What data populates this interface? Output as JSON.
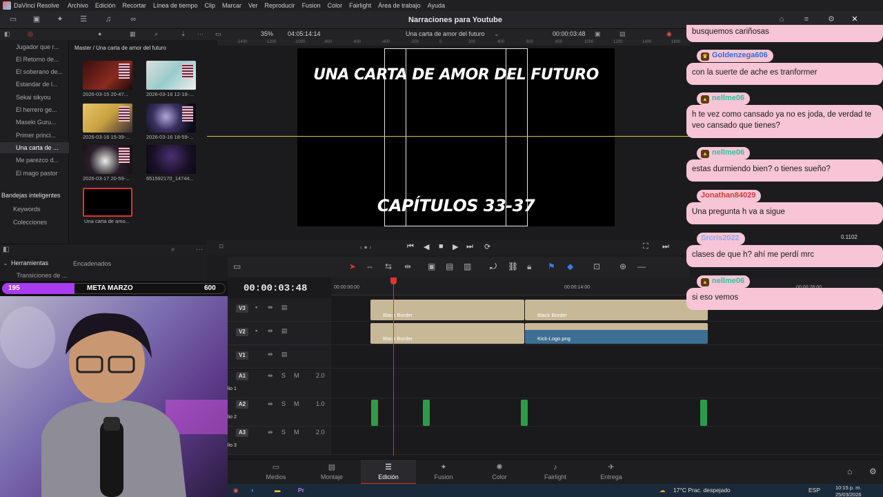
{
  "menubar": {
    "app_name": "DaVinci Resolve",
    "items": [
      "Archivo",
      "Edición",
      "Recortar",
      "Línea de tiempo",
      "Clip",
      "Marcar",
      "Ver",
      "Reproducir",
      "Fusion",
      "Color",
      "Fairlight",
      "Área de trabajo",
      "Ayuda"
    ]
  },
  "toolbar": {
    "project_title": "Narraciones para Youtube"
  },
  "subbar": {
    "zoom": "35%",
    "timecode_left": "04:05:14:14",
    "timeline_name": "Una carta de amor del futuro",
    "timecode_right": "00:00:03:48"
  },
  "bins": {
    "items": [
      "Jugador que r...",
      "El Retorno de...",
      "El soberano de...",
      "Estandar de l...",
      "Sekai sikyou",
      "El herrero ge...",
      "Maseki Guru...",
      "Primer princi...",
      "Una carta de ...",
      "Me parezco d...",
      "El mago pastor"
    ],
    "smart_bins": "Bandejas inteligentes",
    "smart_items": [
      "Keywords",
      "Colecciones"
    ]
  },
  "mediapool": {
    "path": "Master / Una carta de amor del futuro",
    "thumbs": [
      {
        "label": "2026-03-15 20-47..."
      },
      {
        "label": "2026-03-16 12-18-..."
      },
      {
        "label": "2026-03-16 15-39-..."
      },
      {
        "label": "2026-03-16 18-59-..."
      },
      {
        "label": "2026-03-17 20-59-..."
      },
      {
        "label": "651592170_14744..."
      },
      {
        "label": "Una carta de amo..."
      }
    ]
  },
  "viewer": {
    "title_text": "UNA CARTA DE AMOR DEL FUTURO",
    "chapter_text": "CAPÍTULOS 33-37",
    "ruler_ticks": [
      "-1400",
      "-1200",
      "-1000",
      "-800",
      "-600",
      "-400",
      "-200",
      "0",
      "200",
      "400",
      "600",
      "800",
      "1000",
      "1200",
      "1400",
      "1600"
    ]
  },
  "lower_left": {
    "effects_title": "Herramientas",
    "effects_item": "Transiciones de ...",
    "chained": "Encadenados"
  },
  "goal": {
    "current": "195",
    "name": "META MARZO",
    "target": "600",
    "progress": 0.325
  },
  "timeline": {
    "timecode": "00:00:03:48",
    "ruler": [
      "00:00:00:00",
      "00:00:14:00",
      "00:00:28:00"
    ],
    "tracks": [
      {
        "id": "V3"
      },
      {
        "id": "V2"
      },
      {
        "id": "V1"
      }
    ],
    "audio_tracks": [
      {
        "id": "A1",
        "vol": "2.0",
        "label": "lio 1"
      },
      {
        "id": "A2",
        "vol": "1.0",
        "label": "lio 2"
      },
      {
        "id": "A3",
        "vol": "2.0",
        "label": "lio 3"
      }
    ],
    "clips": {
      "v3_a": "Black Border",
      "v3_b": "Black Border",
      "v2_a": "Black Border",
      "v2_b": "Kick-Logo.png"
    }
  },
  "page_tabs": [
    {
      "label": "Medios",
      "icon": "media-icon"
    },
    {
      "label": "Montaje",
      "icon": "cut-icon"
    },
    {
      "label": "Edición",
      "icon": "edit-icon"
    },
    {
      "label": "Fusion",
      "icon": "fusion-icon"
    },
    {
      "label": "Color",
      "icon": "color-icon"
    },
    {
      "label": "Fairlight",
      "icon": "fairlight-icon"
    },
    {
      "label": "Entrega",
      "icon": "deliver-icon"
    }
  ],
  "taskbar": {
    "weather": "17°C  Prac. despejado",
    "lang": "ESP",
    "time": "10:15 p. m.",
    "date": "25/03/2026"
  },
  "inspector_fragment": {
    "value": "0.1102"
  },
  "chat": [
    {
      "name": "",
      "msg": "busquemos cariñosas"
    },
    {
      "name": "Goldenzega606",
      "msg": "con la suerte de ache es tranformer",
      "color": "#2f6fd6"
    },
    {
      "name": "nellme06",
      "msg": "h te vez como cansado ya no es joda, de verdad te veo cansado que tienes?",
      "color": "#2cc4a0"
    },
    {
      "name": "nellme06",
      "msg": "estas durmiendo bien? o tienes sueño?",
      "color": "#2cc4a0"
    },
    {
      "name": "Jonathan84029",
      "msg": "Una pregunta h va a sigue",
      "color": "#d33a3a"
    },
    {
      "name": "Srcris2022",
      "msg": "clases de que h? ahí me perdí mrc",
      "color": "#8fa6f0"
    },
    {
      "name": "nellme06",
      "msg": "si eso vemos",
      "color": "#2cc4a0"
    }
  ],
  "colors": {
    "accent": "#e0342c",
    "chat_bubble": "#f7c5d6",
    "goal_fill": "#a83cf0"
  }
}
